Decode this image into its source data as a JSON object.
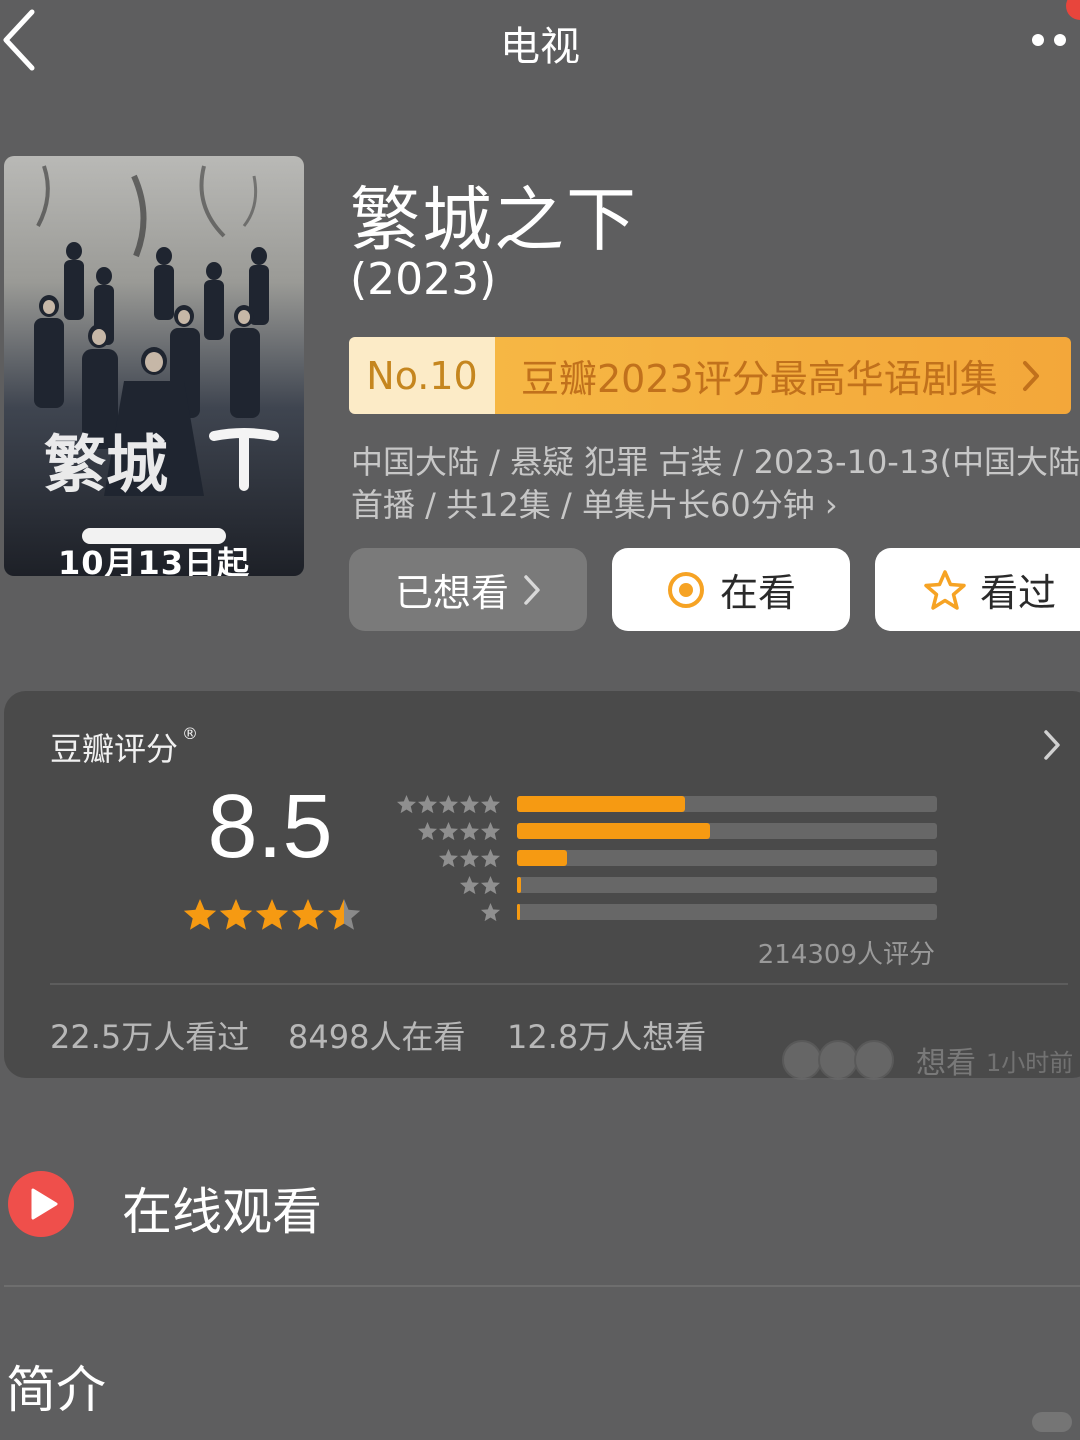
{
  "header": {
    "title": "电视"
  },
  "poster": {
    "date_text": "10月13日起",
    "overlay_title": "繁城之下"
  },
  "show": {
    "title": "繁城之下",
    "year": "(2023)"
  },
  "rank_banner": {
    "rank": "No.10",
    "text": "豆瓣2023评分最高华语剧集"
  },
  "meta": {
    "line1": "中国大陆 / 悬疑 犯罪 古装 / 2023-10-13(中国大陆",
    "line2": "首播 / 共12集 / 单集片长60分钟 ›"
  },
  "actions": {
    "wanted": "已想看",
    "watching": "在看",
    "watched": "看过"
  },
  "rating": {
    "label": "豆瓣评分",
    "registered": "®",
    "score": "8.5",
    "stars": 4.5,
    "count": "214309人评分",
    "distribution": [
      {
        "stars": 5,
        "fraction": 0.4
      },
      {
        "stars": 4,
        "fraction": 0.46
      },
      {
        "stars": 3,
        "fraction": 0.12
      },
      {
        "stars": 2,
        "fraction": 0.01
      },
      {
        "stars": 1,
        "fraction": 0.005
      }
    ],
    "accent_color": "#f69a12"
  },
  "stats": {
    "watched": "22.5万人看过",
    "watching": "8498人在看",
    "want": "12.8万人想看"
  },
  "friend_activity": {
    "action": "想看",
    "time": "1小时前"
  },
  "online": {
    "label": "在线观看",
    "icon": "play-icon",
    "icon_color": "#ef4f4b"
  },
  "intro": {
    "title": "简介"
  }
}
